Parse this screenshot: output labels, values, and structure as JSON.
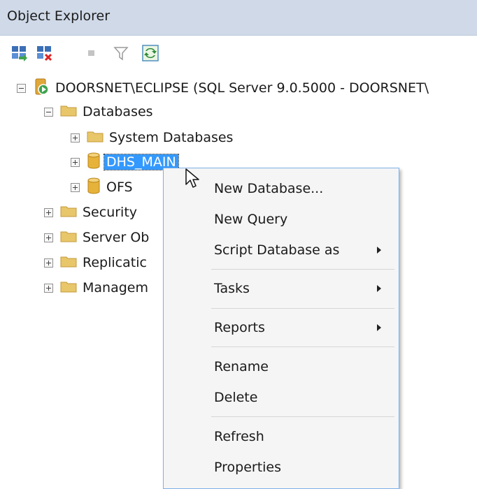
{
  "window": {
    "title": "Object Explorer"
  },
  "toolbar": {
    "buttons": [
      {
        "name": "connect-icon"
      },
      {
        "name": "disconnect-icon"
      },
      {
        "name": "stop-icon"
      },
      {
        "name": "filter-icon"
      },
      {
        "name": "refresh-icon"
      }
    ]
  },
  "tree": {
    "server": "DOORSNET\\ECLIPSE (SQL Server 9.0.5000 - DOORSNET\\",
    "databases": "Databases",
    "system_databases": "System Databases",
    "dhs_main": "DHS_MAIN",
    "ofs": "OFS",
    "security": "Security",
    "server_objects": "Server Ob",
    "replication": "Replicatic",
    "management": "Managem"
  },
  "context_menu": {
    "items": [
      "New Database...",
      "New Query",
      "Script Database as",
      "Tasks",
      "Reports",
      "Rename",
      "Delete",
      "Refresh",
      "Properties"
    ]
  },
  "colors": {
    "titlebar": "#cfd9e8",
    "selection": "#3399ff",
    "folder": "#e8c66a",
    "menu_border": "#7fb0e6"
  }
}
